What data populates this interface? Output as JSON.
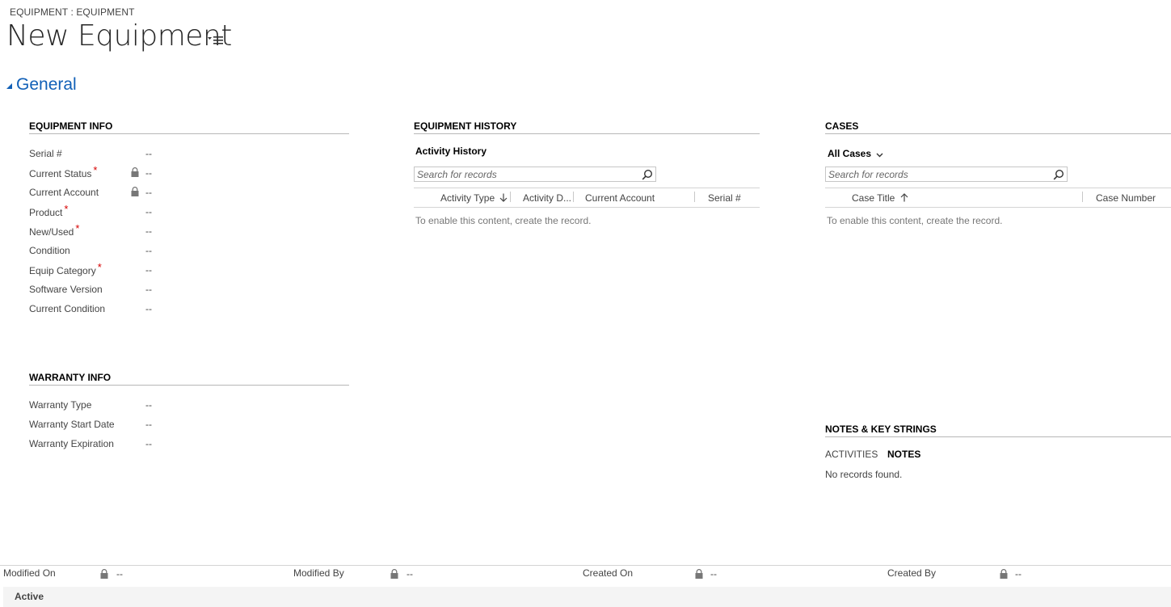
{
  "header": {
    "breadcrumb": "EQUIPMENT : EQUIPMENT",
    "title": "New Equipment"
  },
  "section": {
    "title": "General"
  },
  "equipment_info": {
    "heading": "EQUIPMENT INFO",
    "fields": [
      {
        "label": "Serial #",
        "value": "--",
        "required": false,
        "locked": false
      },
      {
        "label": "Current Status",
        "value": "--",
        "required": true,
        "locked": true
      },
      {
        "label": "Current Account",
        "value": "--",
        "required": false,
        "locked": true
      },
      {
        "label": "Product",
        "value": "--",
        "required": true,
        "locked": false
      },
      {
        "label": "New/Used",
        "value": "--",
        "required": true,
        "locked": false
      },
      {
        "label": "Condition",
        "value": "--",
        "required": false,
        "locked": false
      },
      {
        "label": "Equip Category",
        "value": "--",
        "required": true,
        "locked": false
      },
      {
        "label": "Software Version",
        "value": "--",
        "required": false,
        "locked": false
      },
      {
        "label": "Current Condition",
        "value": "--",
        "required": false,
        "locked": false
      }
    ]
  },
  "warranty_info": {
    "heading": "WARRANTY INFO",
    "fields": [
      {
        "label": "Warranty Type",
        "value": "--"
      },
      {
        "label": "Warranty Start Date",
        "value": "--"
      },
      {
        "label": "Warranty Expiration",
        "value": "--"
      }
    ]
  },
  "equipment_history": {
    "heading": "EQUIPMENT HISTORY",
    "subgrid_title": "Activity History",
    "search_placeholder": "Search for records",
    "columns": [
      "Activity Type",
      "Activity D...",
      "Current Account",
      "Serial #"
    ],
    "empty_message": "To enable this content, create the record."
  },
  "cases": {
    "heading": "CASES",
    "view_selector": "All Cases",
    "search_placeholder": "Search for records",
    "columns": [
      "Case Title",
      "Case Number"
    ],
    "empty_message": "To enable this content, create the record."
  },
  "notes": {
    "heading": "NOTES & KEY STRINGS",
    "tabs": [
      "ACTIVITIES",
      "NOTES"
    ],
    "active_tab": "NOTES",
    "empty_message": "No records found."
  },
  "footer": {
    "fields": [
      {
        "label": "Modified On",
        "value": "--"
      },
      {
        "label": "Modified By",
        "value": "--"
      },
      {
        "label": "Created On",
        "value": "--"
      },
      {
        "label": "Created By",
        "value": "--"
      }
    ],
    "status": "Active"
  },
  "colors": {
    "accent": "#1160b7",
    "required": "#d60000",
    "status_bar": "#f4f4f4"
  }
}
